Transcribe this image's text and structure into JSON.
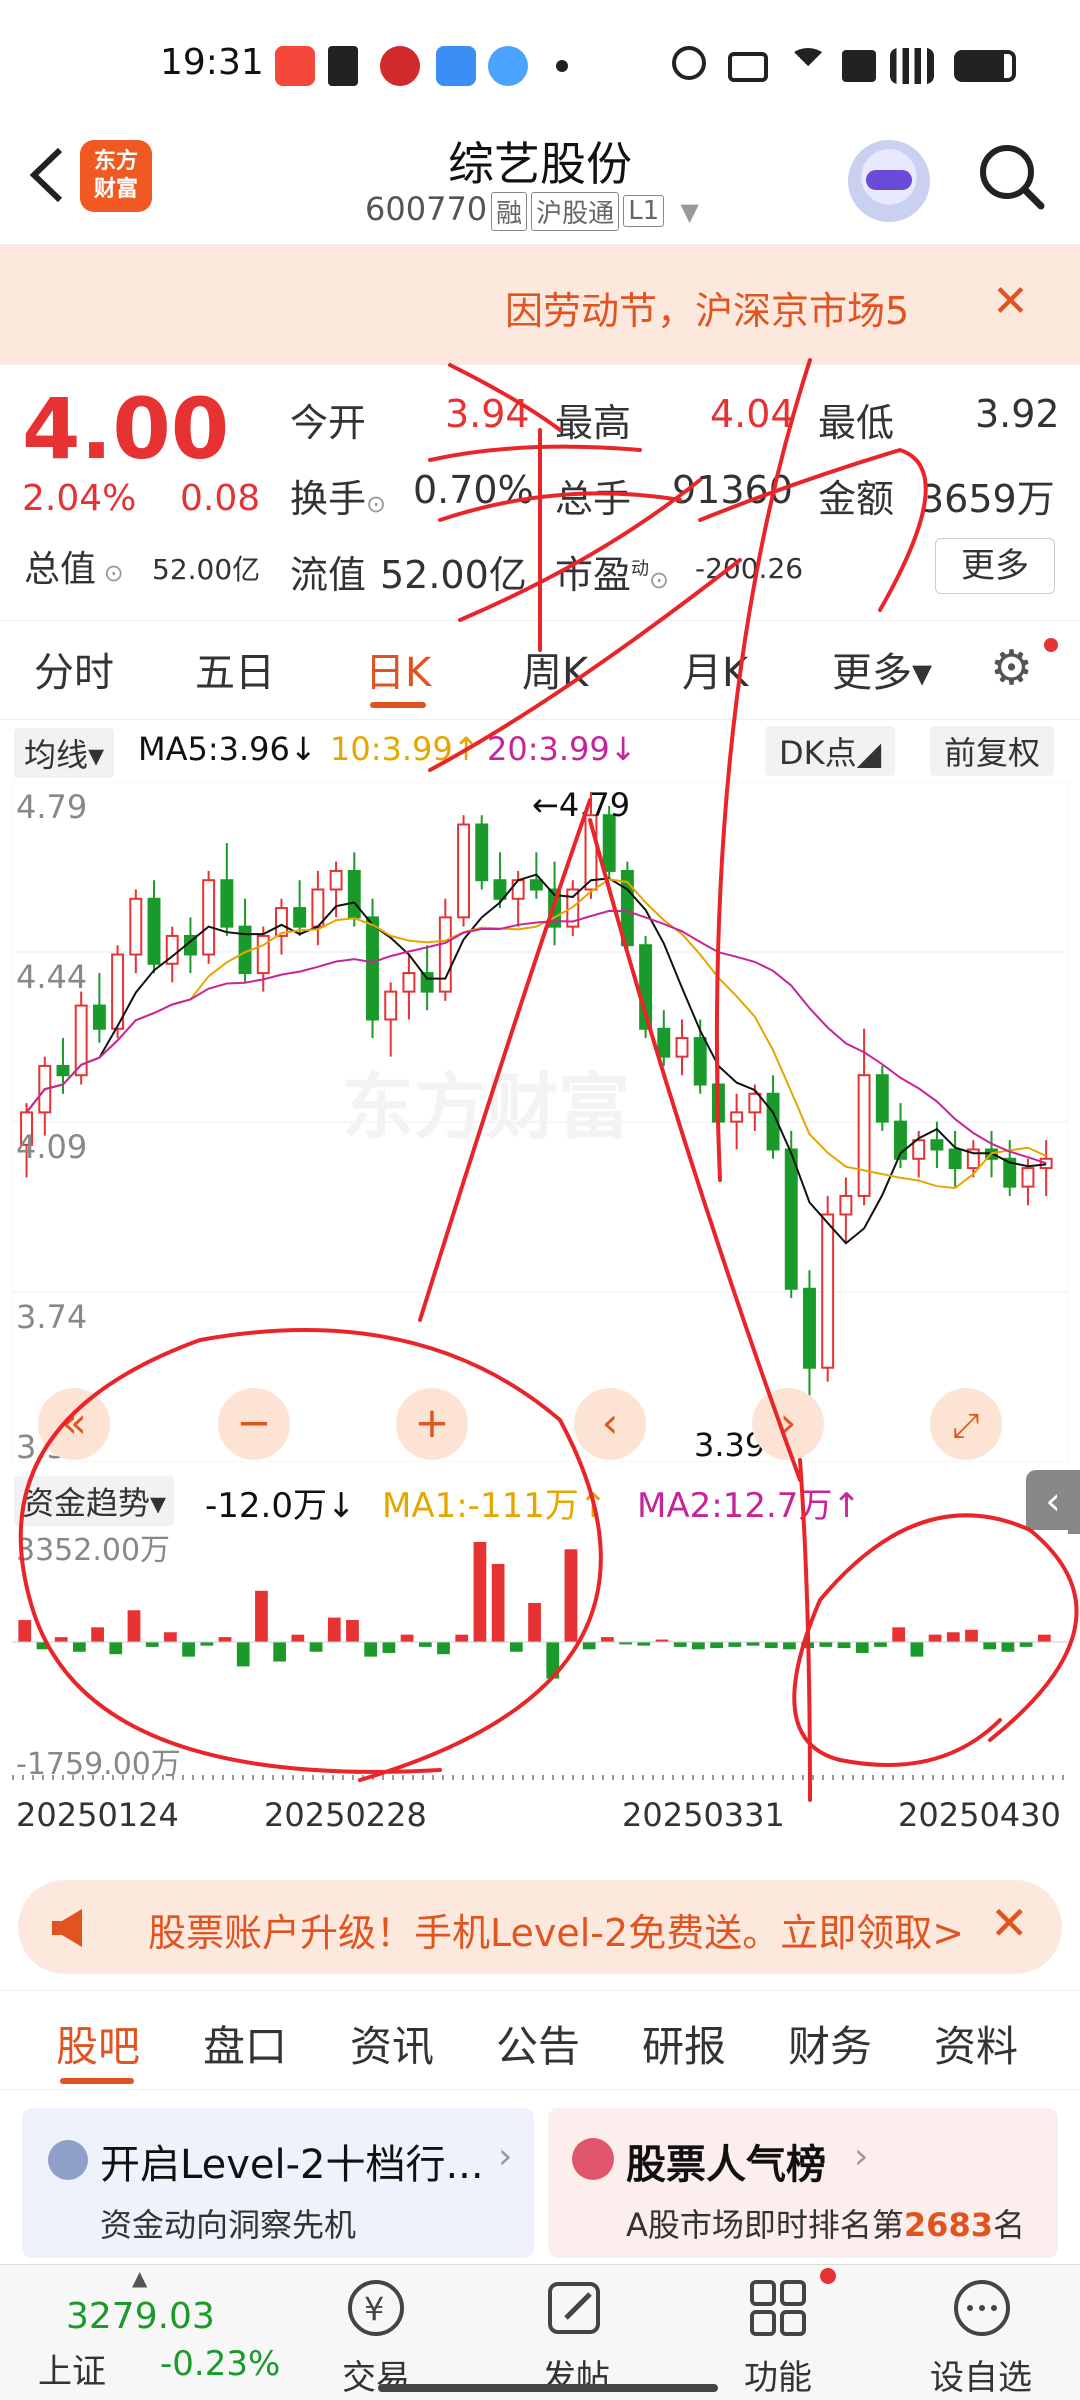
{
  "status_bar": {
    "time": "19:31",
    "icons": [
      "video-app-icon",
      "alipay-icon",
      "bank-app-icon",
      "note-app-icon",
      "cloud-app-icon",
      "dot-icon",
      "alarm-icon",
      "mute-icon",
      "wifi-icon",
      "hd-icon",
      "signal-4g-icon",
      "battery-icon"
    ]
  },
  "header": {
    "logo_text": "东方\n财富",
    "stock_name": "综艺股份",
    "stock_code": "600770",
    "tags": [
      "融",
      "沪股通",
      "L1"
    ]
  },
  "notice": {
    "text": "因劳动节，沪深京市场5",
    "close": "✕"
  },
  "quote": {
    "price": "4.00",
    "change_pct": "2.04%",
    "change": "0.08",
    "total_value_label": "总值",
    "total_value": "52.00亿",
    "open_label": "今开",
    "open": "3.94",
    "high_label": "最高",
    "high": "4.04",
    "low_label": "最低",
    "low": "3.92",
    "turnover_label": "换手",
    "turnover": "0.70%",
    "volume_label": "总手",
    "volume": "91360",
    "amount_label": "金额",
    "amount": "3659万",
    "float_label": "流值",
    "float_value": "52.00亿",
    "pe_label": "市盈",
    "pe_sup": "动",
    "pe": "-200.26",
    "more": "更多",
    "colors": {
      "up": "#e63232",
      "down": "#1a9a2a"
    }
  },
  "period_tabs": [
    "分时",
    "五日",
    "日K",
    "周K",
    "月K",
    "更多▾"
  ],
  "active_period": "日K",
  "ma_legend": {
    "select": "均线▾",
    "ma5": "MA5:3.96↓",
    "ma10": "10:3.99↑",
    "ma20": "20:3.99↓",
    "dk": "DK点◢",
    "adjust": "前复权"
  },
  "kline": {
    "y_labels": [
      "4.79",
      "4.44",
      "4.09",
      "3.74",
      "3.39"
    ],
    "max_label": "←4.79",
    "min_label": "3.39->",
    "watermark": "东方财富",
    "controls": [
      "«",
      "−",
      "+",
      "‹",
      "›"
    ]
  },
  "chart_data": {
    "type": "candlestick",
    "ylim": [
      3.39,
      4.79
    ],
    "ohlc": [
      [
        4.03,
        4.12,
        3.96,
        4.1
      ],
      [
        4.1,
        4.22,
        4.05,
        4.2
      ],
      [
        4.2,
        4.26,
        4.14,
        4.18
      ],
      [
        4.18,
        4.36,
        4.16,
        4.33
      ],
      [
        4.33,
        4.4,
        4.25,
        4.28
      ],
      [
        4.28,
        4.46,
        4.26,
        4.44
      ],
      [
        4.44,
        4.58,
        4.4,
        4.56
      ],
      [
        4.56,
        4.6,
        4.4,
        4.42
      ],
      [
        4.42,
        4.5,
        4.38,
        4.48
      ],
      [
        4.48,
        4.52,
        4.4,
        4.44
      ],
      [
        4.44,
        4.62,
        4.42,
        4.6
      ],
      [
        4.6,
        4.68,
        4.48,
        4.5
      ],
      [
        4.5,
        4.56,
        4.38,
        4.4
      ],
      [
        4.4,
        4.5,
        4.36,
        4.48
      ],
      [
        4.48,
        4.56,
        4.44,
        4.54
      ],
      [
        4.54,
        4.6,
        4.48,
        4.5
      ],
      [
        4.5,
        4.62,
        4.46,
        4.58
      ],
      [
        4.58,
        4.64,
        4.52,
        4.62
      ],
      [
        4.62,
        4.66,
        4.5,
        4.52
      ],
      [
        4.52,
        4.56,
        4.26,
        4.3
      ],
      [
        4.3,
        4.38,
        4.22,
        4.36
      ],
      [
        4.36,
        4.44,
        4.3,
        4.4
      ],
      [
        4.4,
        4.46,
        4.32,
        4.36
      ],
      [
        4.36,
        4.56,
        4.34,
        4.52
      ],
      [
        4.52,
        4.74,
        4.5,
        4.72
      ],
      [
        4.72,
        4.74,
        4.58,
        4.6
      ],
      [
        4.6,
        4.66,
        4.54,
        4.56
      ],
      [
        4.56,
        4.62,
        4.5,
        4.6
      ],
      [
        4.6,
        4.66,
        4.56,
        4.58
      ],
      [
        4.58,
        4.64,
        4.46,
        4.5
      ],
      [
        4.5,
        4.6,
        4.48,
        4.58
      ],
      [
        4.58,
        4.79,
        4.56,
        4.74
      ],
      [
        4.74,
        4.76,
        4.6,
        4.62
      ],
      [
        4.62,
        4.64,
        4.44,
        4.46
      ],
      [
        4.46,
        4.48,
        4.26,
        4.28
      ],
      [
        4.28,
        4.32,
        4.2,
        4.22
      ],
      [
        4.22,
        4.3,
        4.18,
        4.26
      ],
      [
        4.26,
        4.3,
        4.14,
        4.16
      ],
      [
        4.16,
        4.2,
        4.06,
        4.08
      ],
      [
        4.08,
        4.14,
        4.02,
        4.1
      ],
      [
        4.1,
        4.16,
        4.06,
        4.14
      ],
      [
        4.14,
        4.18,
        4.0,
        4.02
      ],
      [
        4.02,
        4.06,
        3.7,
        3.72
      ],
      [
        3.72,
        3.76,
        3.39,
        3.55
      ],
      [
        3.55,
        3.92,
        3.52,
        3.88
      ],
      [
        3.88,
        3.96,
        3.82,
        3.92
      ],
      [
        3.92,
        4.28,
        3.9,
        4.18
      ],
      [
        4.18,
        4.2,
        4.06,
        4.08
      ],
      [
        4.08,
        4.12,
        3.98,
        4.0
      ],
      [
        4.0,
        4.06,
        3.96,
        4.04
      ],
      [
        4.04,
        4.08,
        3.98,
        4.02
      ],
      [
        4.02,
        4.06,
        3.94,
        3.98
      ],
      [
        3.98,
        4.04,
        3.96,
        4.02
      ],
      [
        4.02,
        4.06,
        3.96,
        4.0
      ],
      [
        4.0,
        4.04,
        3.92,
        3.94
      ],
      [
        3.94,
        4.0,
        3.9,
        3.98
      ],
      [
        3.98,
        4.04,
        3.92,
        4.0
      ]
    ]
  },
  "fund_flow": {
    "select": "资金趋势▾",
    "value": "-12.0万↓",
    "ma1": "MA1:-111万↑",
    "ma2": "MA2:12.7万↑",
    "y_top": "3352.00万",
    "y_bottom": "-1759.00万",
    "toggle": "‹",
    "bars": [
      180,
      -60,
      40,
      -80,
      120,
      -100,
      260,
      -40,
      80,
      -120,
      -30,
      40,
      -200,
      420,
      -160,
      60,
      -80,
      200,
      180,
      -120,
      -90,
      60,
      -40,
      -100,
      60,
      820,
      640,
      -80,
      320,
      -300,
      760,
      -60,
      40,
      -20,
      -30,
      20,
      -40,
      -60,
      -50,
      -40,
      -30,
      -50,
      -60,
      -50,
      -40,
      -50,
      -90,
      -40,
      120,
      -120,
      60,
      80,
      100,
      -60,
      -80,
      -40,
      60
    ]
  },
  "dates": [
    "20250124",
    "20250228",
    "20250331",
    "20250430"
  ],
  "promo": {
    "text": "股票账户升级！手机Level-2免费送。立即领取>",
    "close": "✕"
  },
  "content_tabs": [
    "股吧",
    "盘口",
    "资讯",
    "公告",
    "研报",
    "财务",
    "资料"
  ],
  "active_content_tab": "股吧",
  "cards": {
    "level2_title": "开启Level-2十档行...",
    "level2_sub": "资金动向洞察先机",
    "popular_title": "股票人气榜",
    "popular_sub_prefix": "A股市场即时排名第",
    "popular_rank": "2683",
    "popular_sub_suffix": "名"
  },
  "bottom_bar": {
    "index_value": "3279.03",
    "index_name": "上证",
    "index_pct": "-0.23%",
    "nav": [
      "交易",
      "发帖",
      "功能",
      "设自选"
    ]
  }
}
